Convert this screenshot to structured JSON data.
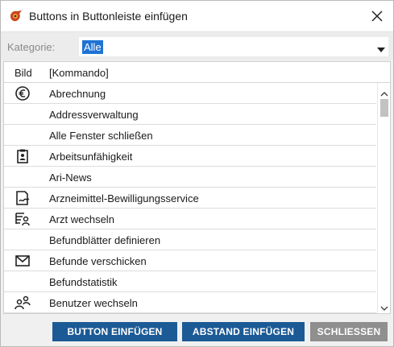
{
  "window": {
    "title": "Buttons in Buttonleiste einfügen",
    "icon": "app-logo-icon",
    "close_icon": "close-icon"
  },
  "filter": {
    "label": "Kategorie:",
    "selected": "Alle"
  },
  "list": {
    "columns": [
      "Bild",
      "[Kommando]"
    ],
    "rows": [
      {
        "label": "Abrechnung",
        "icon": "euro-icon"
      },
      {
        "label": "Addressverwaltung",
        "icon": ""
      },
      {
        "label": "Alle Fenster schließen",
        "icon": ""
      },
      {
        "label": "Arbeitsunfähigkeit",
        "icon": "clipboard-id-icon"
      },
      {
        "label": "Ari-News",
        "icon": ""
      },
      {
        "label": "Arzneimittel-Bewilligungsservice",
        "icon": "document-sign-icon"
      },
      {
        "label": "Arzt wechseln",
        "icon": "list-user-icon"
      },
      {
        "label": "Befundblätter definieren",
        "icon": ""
      },
      {
        "label": "Befunde verschicken",
        "icon": "envelope-icon"
      },
      {
        "label": "Befundstatistik",
        "icon": ""
      },
      {
        "label": "Benutzer wechseln",
        "icon": "switch-users-icon"
      }
    ]
  },
  "buttons": {
    "insert": "BUTTON EINFÜGEN",
    "spacing": "ABSTAND EINFÜGEN",
    "close": "SCHLIESSEN"
  },
  "colors": {
    "primary_button": "#1c5a96",
    "disabled_button": "#8f8f8f",
    "selection": "#1e73d4"
  }
}
